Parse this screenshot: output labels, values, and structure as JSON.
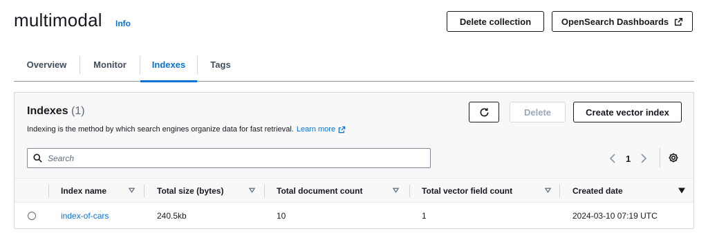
{
  "page": {
    "title": "multimodal",
    "info": "Info",
    "delete_collection": "Delete collection",
    "dashboards": "OpenSearch Dashboards"
  },
  "tabs": [
    {
      "label": "Overview"
    },
    {
      "label": "Monitor"
    },
    {
      "label": "Indexes"
    },
    {
      "label": "Tags"
    }
  ],
  "panel": {
    "title": "Indexes",
    "count": "(1)",
    "description": "Indexing is the method by which search engines organize data for fast retrieval.",
    "learn_more": "Learn more",
    "delete": "Delete",
    "create": "Create vector index",
    "search_placeholder": "Search",
    "page": "1"
  },
  "table": {
    "columns": [
      "Index name",
      "Total size (bytes)",
      "Total document count",
      "Total vector field count",
      "Created date"
    ],
    "rows": [
      {
        "name": "index-of-cars",
        "size": "240.5kb",
        "docs": "10",
        "vectors": "1",
        "created": "2024-03-10 07:19 UTC"
      }
    ]
  },
  "colors": {
    "accent": "#0972d3",
    "text": "#16191f",
    "border": "#d5dbdb"
  },
  "icons": [
    "external-link-icon",
    "refresh-icon",
    "search-icon",
    "chevron-left-icon",
    "chevron-right-icon",
    "gear-icon",
    "sort-icon",
    "sort-desc-icon"
  ]
}
